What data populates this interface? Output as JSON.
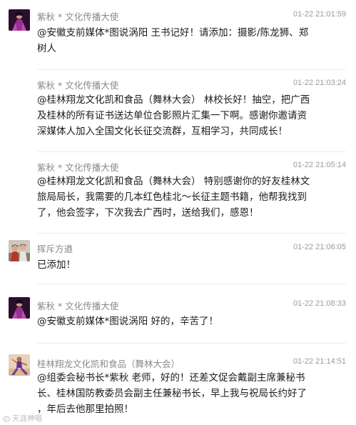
{
  "messages": [
    {
      "sender": "紫秋 * 文化传播大使",
      "time": "01-22 21:01:59",
      "avatar": "purple-dress-woman-avatar",
      "lines": [
        "@安徽支前媒体*图说涡阳 王书记好！请添加：摄影/陈龙狮、郑",
        "树人"
      ]
    },
    {
      "sender": "紫秋 * 文化传播大使",
      "time": "01-22 21:03:24",
      "avatar": "none",
      "lines": [
        "@桂林翔龙文化凯和食品（舞林大会） 林校长好！抽空，把广西",
        "及桂林的所有证书送达单位合影照片汇集一下啊。感谢你邀请资",
        "深媒体人加入全国文化长征交流群，互相学习，共同成长！"
      ]
    },
    {
      "sender": "紫秋 * 文化传播大使",
      "time": "01-22 21:05:14",
      "avatar": "none",
      "lines": [
        "@桂林翔龙文化凯和食品（舞林大会） 特别感谢你的好友桂林文",
        "旅局局长，我需要的几本红色桂北～长征主题书籍，他帮我找到",
        "了，他会签字，下次我去广西时，送给我们，感恩！"
      ]
    },
    {
      "sender": "挥斥方遒",
      "time": "01-22 21:06:05",
      "avatar": "couple-photo-avatar",
      "lines": [
        "已添加！"
      ]
    },
    {
      "sender": "紫秋 * 文化传播大使",
      "time": "01-22 21:08:33",
      "avatar": "purple-dress-woman-avatar",
      "lines": [
        "@安徽支前媒体*图说涡阳 好的，辛苦了！"
      ]
    },
    {
      "sender": "桂林翔龙文化凯和食品（舞林大会）",
      "time": "01-22 21:14:51",
      "avatar": "dancer-avatar",
      "lines": [
        "@组委会秘书长*紫秋 老师，好的！还差文促会戴副主席兼秘书",
        "长、桂林国防教委员会副主任兼秘书长，早上我与祝局长约好了",
        "，年后去他那里拍照！"
      ]
    }
  ],
  "watermark": "天涯神唱"
}
